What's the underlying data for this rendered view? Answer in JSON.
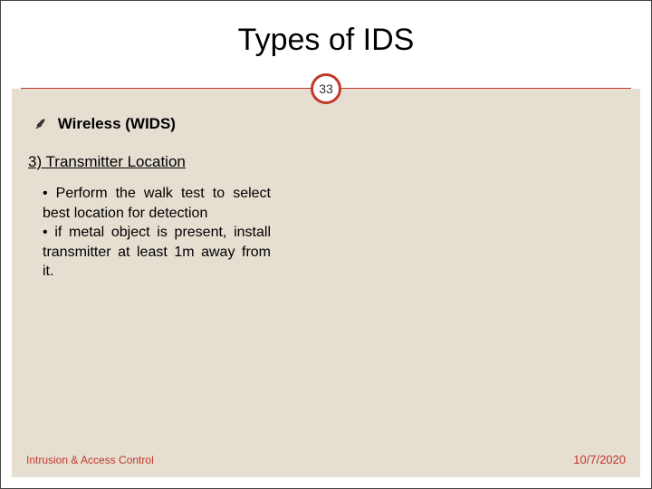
{
  "title": "Types of IDS",
  "page_number": "33",
  "subheading": "Wireless (WIDS)",
  "section": "3) Transmitter Location",
  "bullets": [
    "• Perform the walk test to select best location for detection",
    "• if metal object is present, install transmitter at least 1m away from it."
  ],
  "footer": {
    "left": "Intrusion & Access Control",
    "right": "10/7/2020"
  }
}
